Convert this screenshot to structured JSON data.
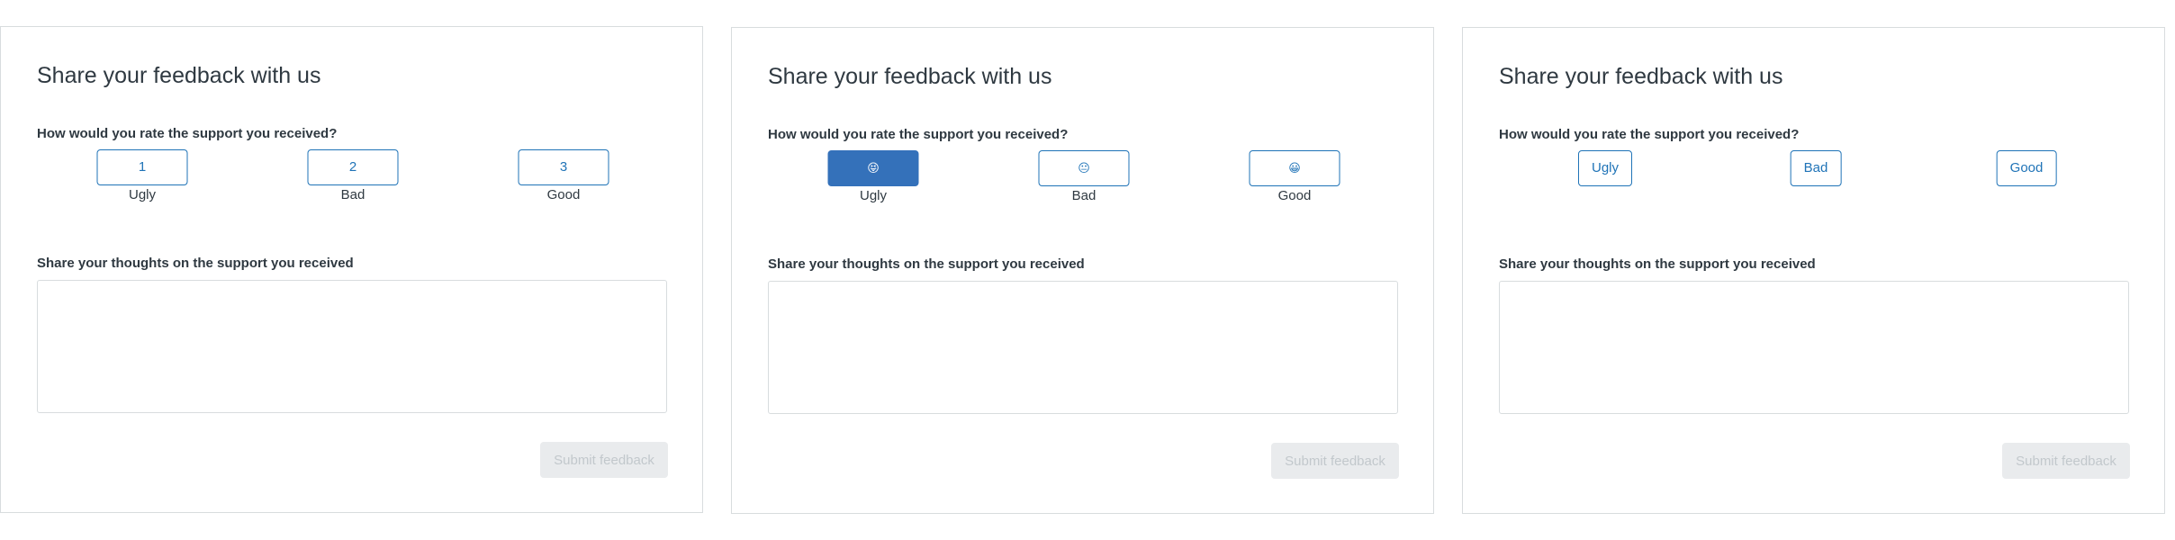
{
  "cards": [
    {
      "title": "Share your feedback with us",
      "rating_question": "How would you rate the support you received?",
      "options": [
        {
          "button": "1",
          "caption": "Ugly"
        },
        {
          "button": "2",
          "caption": "Bad"
        },
        {
          "button": "3",
          "caption": "Good"
        }
      ],
      "thoughts_label": "Share your thoughts on the support you received",
      "thoughts_value": "",
      "submit_label": "Submit feedback"
    },
    {
      "title": "Share your feedback with us",
      "rating_question": "How would you rate the support you received?",
      "options": [
        {
          "button": "😝",
          "icon": "tongue-out-face-icon",
          "caption": "Ugly",
          "selected": true
        },
        {
          "button": "😐",
          "icon": "neutral-face-icon",
          "caption": "Bad"
        },
        {
          "button": "😀",
          "icon": "smiling-face-icon",
          "caption": "Good"
        }
      ],
      "thoughts_label": "Share your thoughts on the support you received",
      "thoughts_value": "",
      "submit_label": "Submit feedback"
    },
    {
      "title": "Share your feedback with us",
      "rating_question": "How would you rate the support you received?",
      "options": [
        {
          "button": "Ugly"
        },
        {
          "button": "Bad"
        },
        {
          "button": "Good"
        }
      ],
      "thoughts_label": "Share your thoughts on the support you received",
      "thoughts_value": "",
      "submit_label": "Submit feedback"
    }
  ],
  "colors": {
    "accent": "#1f73b7",
    "selected_fill": "#3471ba",
    "border": "#d8dcde",
    "disabled_bg": "#e9ebed",
    "disabled_text": "#c2c8cc"
  }
}
